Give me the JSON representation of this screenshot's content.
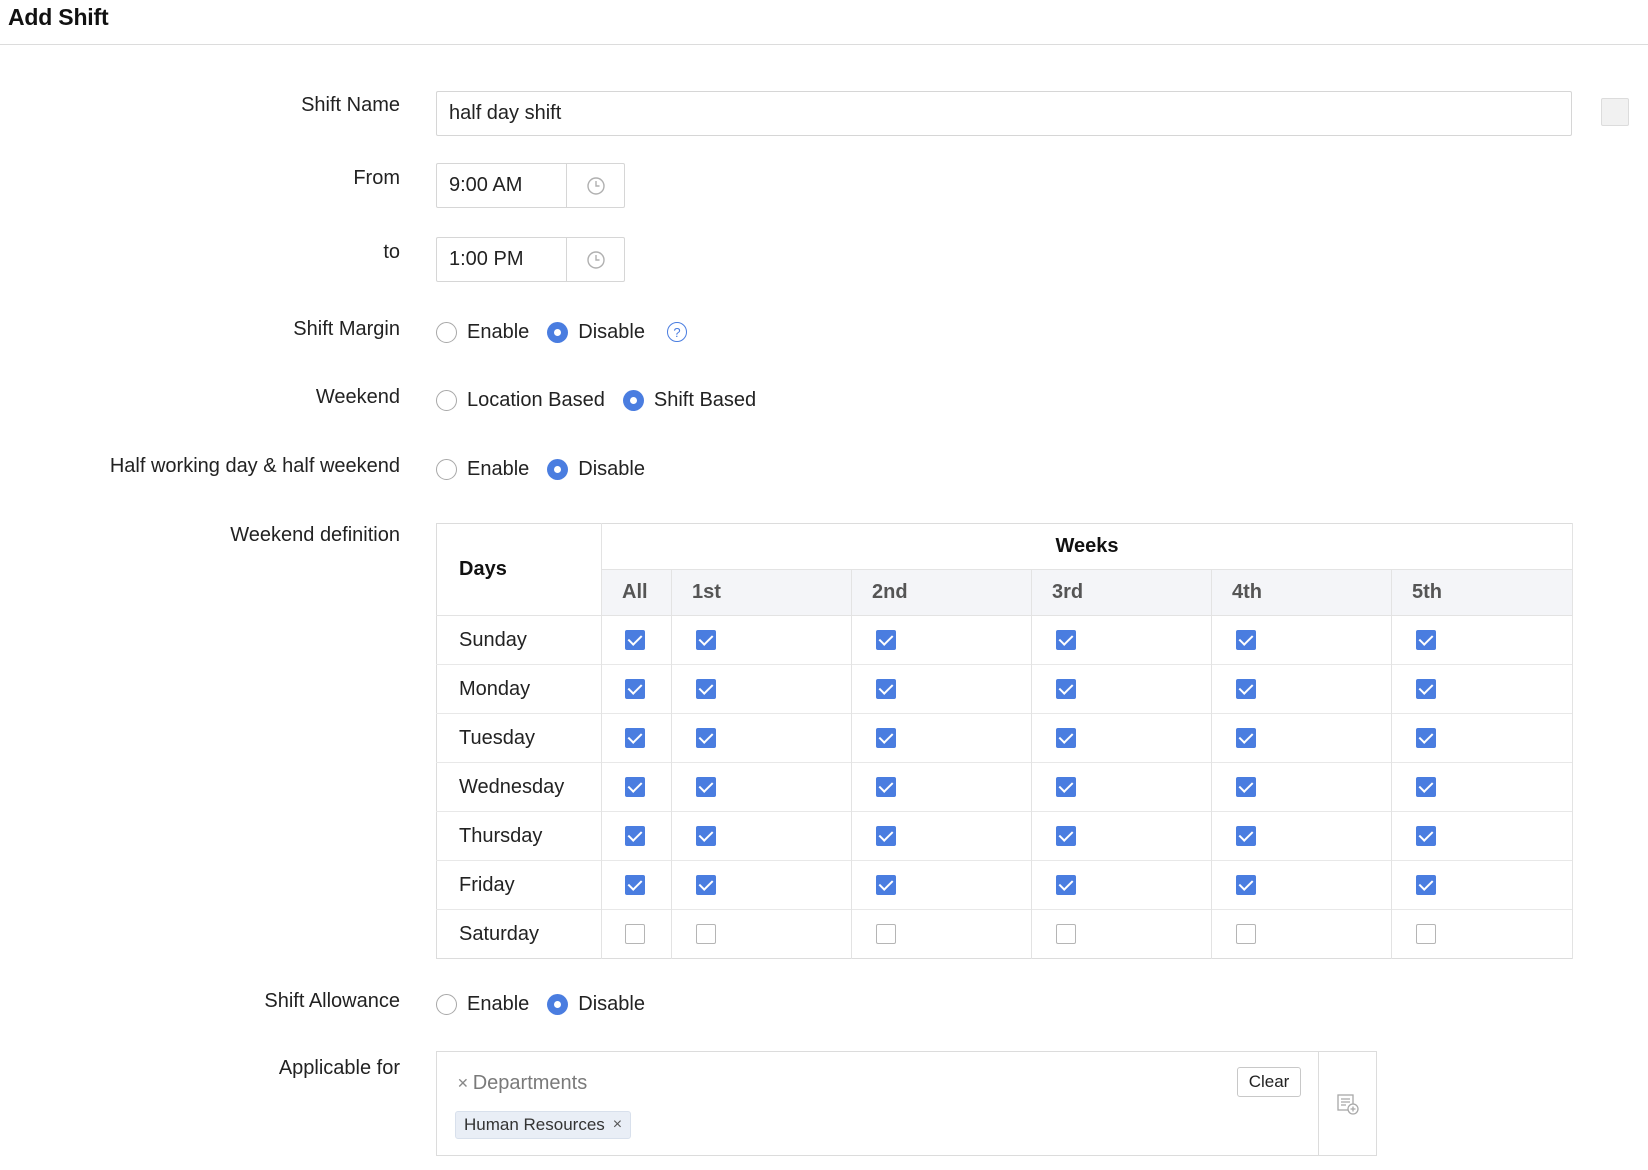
{
  "page": {
    "title": "Add Shift"
  },
  "form": {
    "shift_name": {
      "label": "Shift Name",
      "value": "half day shift"
    },
    "from": {
      "label": "From",
      "value": "9:00 AM"
    },
    "to": {
      "label": "to",
      "value": "1:00 PM"
    },
    "shift_margin": {
      "label": "Shift Margin",
      "options": [
        "Enable",
        "Disable"
      ],
      "selected": "Disable",
      "help_icon": "question-circle-icon"
    },
    "weekend": {
      "label": "Weekend",
      "options": [
        "Location Based",
        "Shift Based"
      ],
      "selected": "Shift Based"
    },
    "half_working": {
      "label": "Half working day & half weekend",
      "options": [
        "Enable",
        "Disable"
      ],
      "selected": "Disable"
    },
    "weekend_definition": {
      "label": "Weekend definition",
      "days_header": "Days",
      "weeks_header": "Weeks",
      "week_columns": [
        "All",
        "1st",
        "2nd",
        "3rd",
        "4th",
        "5th"
      ],
      "rows": [
        {
          "day": "Sunday",
          "checked": [
            true,
            true,
            true,
            true,
            true,
            true
          ]
        },
        {
          "day": "Monday",
          "checked": [
            true,
            true,
            true,
            true,
            true,
            true
          ]
        },
        {
          "day": "Tuesday",
          "checked": [
            true,
            true,
            true,
            true,
            true,
            true
          ]
        },
        {
          "day": "Wednesday",
          "checked": [
            true,
            true,
            true,
            true,
            true,
            true
          ]
        },
        {
          "day": "Thursday",
          "checked": [
            true,
            true,
            true,
            true,
            true,
            true
          ]
        },
        {
          "day": "Friday",
          "checked": [
            true,
            true,
            true,
            true,
            true,
            true
          ]
        },
        {
          "day": "Saturday",
          "checked": [
            false,
            false,
            false,
            false,
            false,
            false
          ]
        }
      ]
    },
    "shift_allowance": {
      "label": "Shift Allowance",
      "options": [
        "Enable",
        "Disable"
      ],
      "selected": "Disable"
    },
    "applicable_for": {
      "label": "Applicable for",
      "category": "Departments",
      "clear_label": "Clear",
      "chips": [
        "Human Resources"
      ]
    }
  },
  "colors": {
    "accent": "#4a7de0",
    "border": "#dcdcdc",
    "header_bg": "#f4f5f8"
  }
}
